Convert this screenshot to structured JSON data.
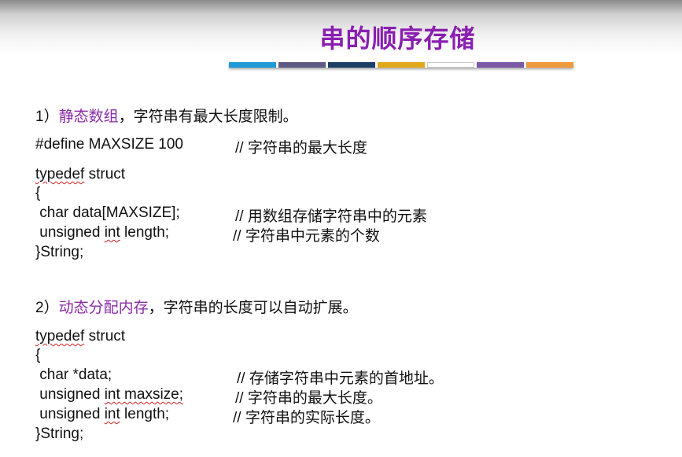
{
  "title": "串的顺序存储",
  "colorbar": [
    "#1f9ad6",
    "#5e5a83",
    "#1c3f66",
    "#e0a81a",
    "#ffffff",
    "#7a5aa6",
    "#ef9a3c"
  ],
  "section1": {
    "num": "1）",
    "keyword": "静态数组",
    "rest": "，字符串有最大长度限制。"
  },
  "define_line": {
    "code": "#define MAXSIZE 100",
    "comment": "// 字符串的最大长度"
  },
  "typedef_kw": "typedef",
  "struct_kw": "struct",
  "open_brace": "{",
  "static_fields": [
    {
      "code": " char data[MAXSIZE];",
      "comment": "// 用数组存储字符串中的元素"
    },
    {
      "pre": " unsigned ",
      "kw": "int",
      "post": " length;",
      "comment": "// 字符串中元素的个数"
    }
  ],
  "close1": "}String;",
  "section2": {
    "num": "2）",
    "keyword": "动态分配内存",
    "rest": "，字符串的长度可以自动扩展。"
  },
  "dynamic_fields": [
    {
      "code": " char *data;",
      "comment": "// 存储字符串中元素的首地址。"
    },
    {
      "pre": " unsigned ",
      "kw": "int",
      "post": " maxsize;",
      "comment": "// 字符串的最大长度。"
    },
    {
      "pre": " unsigned ",
      "kw": "int",
      "post": " length;",
      "comment": "// 字符串的实际长度。"
    }
  ],
  "close2": "}String;"
}
